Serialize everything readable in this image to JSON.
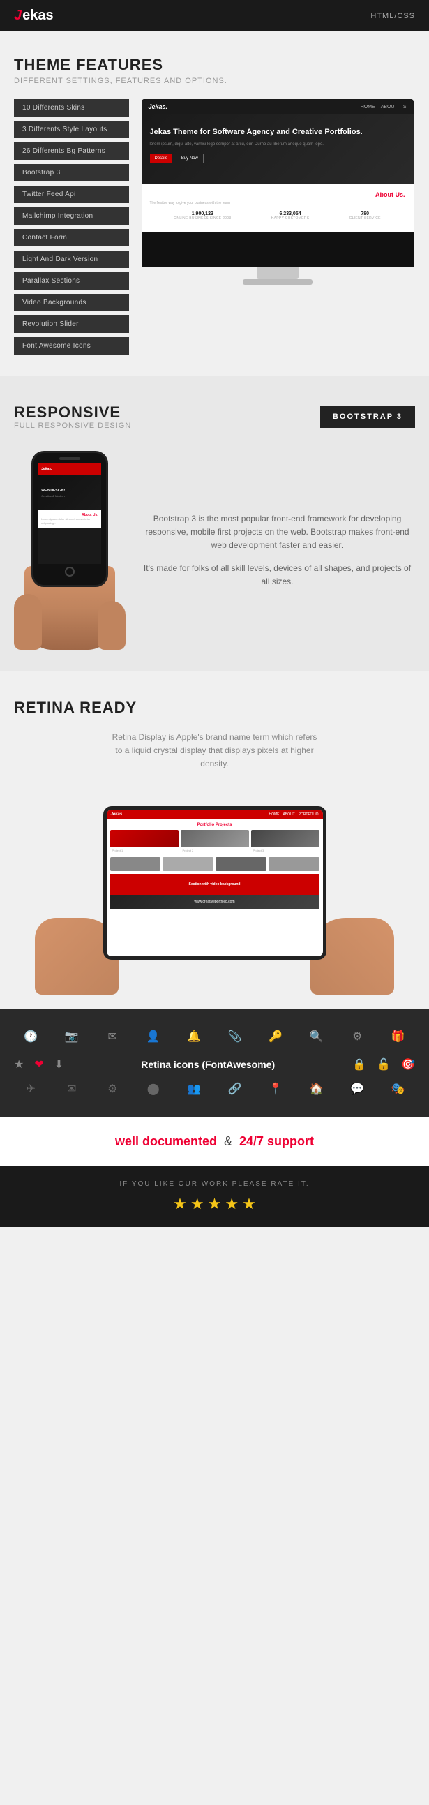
{
  "header": {
    "logo": "ekas",
    "logo_letter": "J",
    "nav_right": "HTML/CSS"
  },
  "features_section": {
    "title": "THEME FEATURES",
    "subtitle": "DIFFERENT SETTINGS, FEATURES AND OPTIONS.",
    "buttons": [
      "10 Differents Skins",
      "3 Differents Style Layouts",
      "26 Differents Bg Patterns",
      "Bootstrap 3",
      "Twitter Feed Api",
      "Mailchimp Integration",
      "Contact Form",
      "Light And Dark Version",
      "Parallax Sections",
      "Video Backgrounds",
      "Revolution Slider",
      "Font Awesome Icons"
    ],
    "monitor": {
      "logo": "Jekas.",
      "nav_links": [
        "HOME",
        "ABOUT",
        "S"
      ],
      "hero_title": "Jekas Theme for Software Agency and Creative Portfolios.",
      "hero_text": "lorem ipsum, diqui alte, varnisi lego sempor at arcu, eur. Durno au liberum aneque quam lopo.",
      "btn_details": "Details",
      "btn_buy": "Buy Now",
      "about_title": "About Us.",
      "about_text": "The flexible way to give your business with the team",
      "stat1_num": "1,900,123",
      "stat1_label": "ONLINE BUSINESS SINCE 2003",
      "stat2_num": "6,233,054",
      "stat2_label": "HAPPY CUSTOMERS",
      "stat3_num": "780",
      "stat3_label": "CLIENT SERVICE"
    }
  },
  "responsive_section": {
    "title": "RESPONSIVE",
    "subtitle": "FULL RESPONSIVE DESIGN",
    "badge": "BOOTSTRAP 3",
    "text1": "Bootstrap 3 is the most popular front-end framework for developing responsive, mobile first projects on the web. Bootstrap makes front-end web development faster and easier.",
    "text2": "It's made for folks of all skill levels, devices of all shapes, and projects of all sizes."
  },
  "retina_section": {
    "title": "RETINA READY",
    "text": "Retina Display is Apple's brand name term which refers to a liquid crystal display that displays pixels at higher density."
  },
  "icons_section": {
    "label": "Retina icons (FontAwesome)",
    "icons_row1": [
      "⏰",
      "📷",
      "✉",
      "👤",
      "🔔",
      "📎",
      "🔑",
      "🔍",
      "⚙",
      "🎁"
    ],
    "icons_row2_left": [
      "⭐",
      "❤",
      "⬇"
    ],
    "icons_row2_right": [
      "🔒",
      "🔒",
      "🎯"
    ],
    "icons_row3": [
      "✈",
      "✉",
      "⚙",
      "🔵",
      "👥",
      "🔗",
      "📍",
      "🏠",
      "💬",
      "🎭"
    ]
  },
  "documented_section": {
    "link_text": "well documented",
    "amp": "&",
    "support_text": "24/7 support"
  },
  "rate_section": {
    "text": "IF YOU LIKE OUR WORK PLEASE RATE IT.",
    "stars": [
      "★",
      "★",
      "★",
      "★",
      "★"
    ]
  }
}
